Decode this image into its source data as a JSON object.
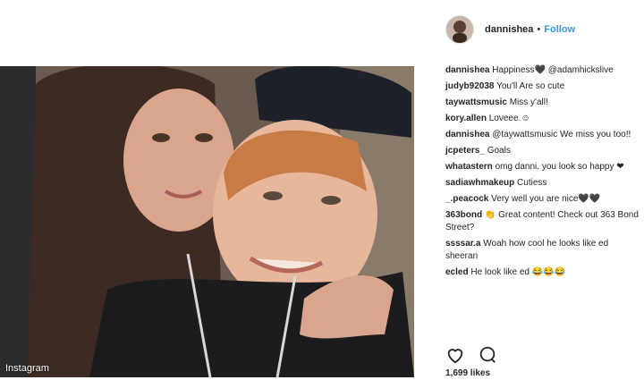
{
  "post": {
    "photo_credit": "Instagram",
    "username": "dannishea",
    "separator": "•",
    "follow_label": "Follow",
    "likes": "1,699 likes"
  },
  "comments": [
    {
      "user": "dannishea",
      "text": "Happiness🖤 @adamhickslive"
    },
    {
      "user": "judyb92038",
      "text": "You'll Are so cute"
    },
    {
      "user": "taywattsmusic",
      "text": "Miss y'all!"
    },
    {
      "user": "kory.allen",
      "text": "Loveee.☺"
    },
    {
      "user": "dannishea",
      "text": "@taywattsmusic We miss you too!!"
    },
    {
      "user": "jcpeters_",
      "text": "Goals"
    },
    {
      "user": "whatastern",
      "text": "omg danni. you look so happy ❤"
    },
    {
      "user": "sadiawhmakeup",
      "text": "Cutiess"
    },
    {
      "user": "_.peacock",
      "text": "Very well you are nice🖤🖤"
    },
    {
      "user": "363bond",
      "text": "👏 Great content! Check out 363 Bond Street?"
    },
    {
      "user": "ssssar.a",
      "text": "Woah how cool he looks like ed sheeran"
    },
    {
      "user": "ecled",
      "text": "He look like ed 😂😂😂"
    }
  ],
  "icons": {
    "like": "heart-icon",
    "comment": "comment-icon"
  }
}
